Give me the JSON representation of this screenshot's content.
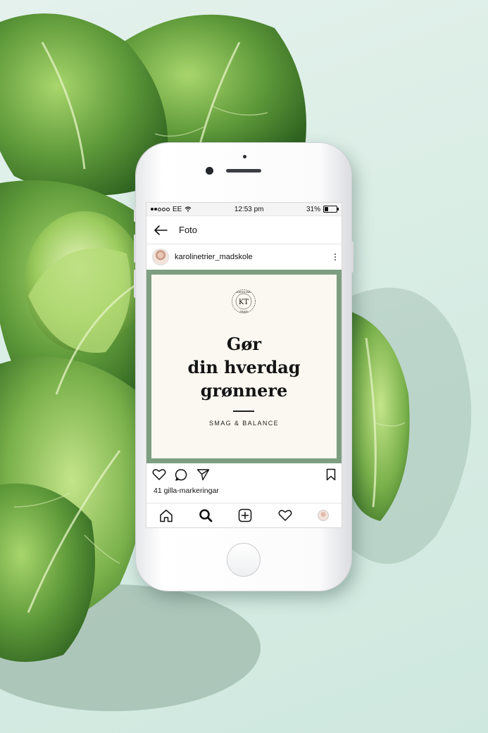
{
  "colors": {
    "background": "#d6ece3",
    "post_frame": "#7d9e80",
    "post_card": "#faf8f0",
    "leaf_dark": "#3f7a2c",
    "leaf_light": "#8fc45a"
  },
  "status_bar": {
    "carrier": "EE",
    "time": "12:53 pm",
    "battery": "31%",
    "icons": [
      "signal-dots-icon",
      "wifi-icon",
      "battery-icon"
    ]
  },
  "nav": {
    "back_icon": "arrow-left-icon",
    "title": "Foto"
  },
  "post": {
    "username": "karolinetrier_madskole",
    "more_icon": "vertical-dots-icon",
    "logo": {
      "initials": "KT",
      "ring_text_top": "KAROLINE",
      "ring_text_bottom": "TRIER"
    },
    "headline_lines": [
      "Gør",
      "din hverdag",
      "grønnere"
    ],
    "tagline": "SMAG & BALANCE",
    "likes": "41 gilla-markeringar"
  },
  "actions": [
    "heart-icon",
    "comment-icon",
    "send-icon",
    "bookmark-icon"
  ],
  "tab_bar": [
    "home-icon",
    "search-icon",
    "add-post-icon",
    "activity-heart-icon",
    "profile-avatar"
  ]
}
